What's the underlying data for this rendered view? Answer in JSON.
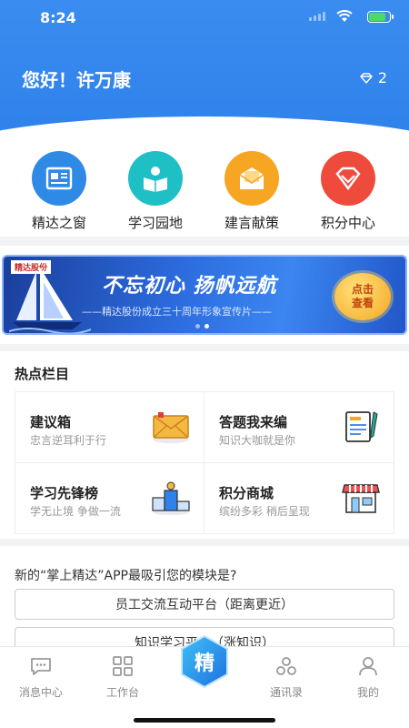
{
  "status": {
    "time": "8:24"
  },
  "header": {
    "greeting": "您好！许万康",
    "gem_count": "2"
  },
  "quick_links": [
    {
      "label": "精达之窗",
      "icon": "newspaper-icon",
      "color": "#2f8ae6"
    },
    {
      "label": "学习园地",
      "icon": "reading-icon",
      "color": "#1fbfc6"
    },
    {
      "label": "建言献策",
      "icon": "envelope-icon",
      "color": "#f6a623"
    },
    {
      "label": "积分中心",
      "icon": "diamond-icon",
      "color": "#ef4b3c"
    }
  ],
  "banner": {
    "brand": "精达股份",
    "headline": "不忘初心 扬帆远航",
    "subtitle": "——精达股份成立三十周年形象宣传片——",
    "cta_line1": "点击",
    "cta_line2": "查看"
  },
  "hot": {
    "title": "热点栏目",
    "items": [
      {
        "title": "建议箱",
        "subtitle": "忠言逆耳利于行",
        "icon": "envelope-icon"
      },
      {
        "title": "答题我来编",
        "subtitle": "知识大咖就是你",
        "icon": "notepad-pen-icon"
      },
      {
        "title": "学习先锋榜",
        "subtitle": "学无止境 争做一流",
        "icon": "podium-icon"
      },
      {
        "title": "积分商城",
        "subtitle": "缤纷多彩 稍后呈现",
        "icon": "store-icon"
      }
    ]
  },
  "poll": {
    "question": "新的“掌上精达”APP最吸引您的模块是?",
    "options": [
      "员工交流互动平台（距离更近）",
      "知识学习平台（涨知识）"
    ]
  },
  "tabs": [
    {
      "label": "消息中心",
      "icon": "chat-bubble-icon"
    },
    {
      "label": "工作台",
      "icon": "grid-icon"
    },
    {
      "label": "精",
      "icon": "center-hexagon-icon"
    },
    {
      "label": "通讯录",
      "icon": "contacts-icon"
    },
    {
      "label": "我的",
      "icon": "user-icon"
    }
  ]
}
